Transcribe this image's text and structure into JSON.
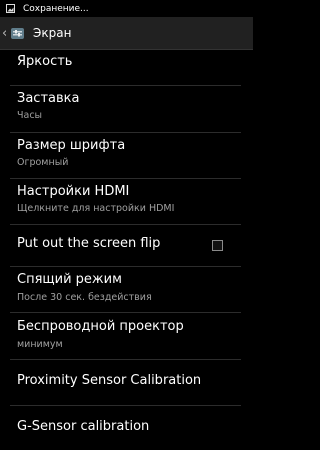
{
  "status_bar": {
    "notification": "Сохранение..."
  },
  "action_bar": {
    "title": "Экран"
  },
  "settings": {
    "brightness": {
      "title": "Яркость"
    },
    "screensaver": {
      "title": "Заставка",
      "summary": "Часы"
    },
    "font_size": {
      "title": "Размер шрифта",
      "summary": "Огромный"
    },
    "hdmi": {
      "title": "Настройки HDMI",
      "summary": "Щелкните для настройки HDMI"
    },
    "screen_flip": {
      "title": "Put out the screen flip",
      "checked": false
    },
    "sleep": {
      "title": "Спящий режим",
      "summary": "После 30 сек. бездействия"
    },
    "wireless_projector": {
      "title": "Беспроводной проектор",
      "summary": "минимум"
    },
    "proximity": {
      "title": "Proximity Sensor Calibration"
    },
    "gsensor": {
      "title": "G-Sensor calibration"
    }
  },
  "colors": {
    "background": "#000000",
    "action_bar": "#212121",
    "summary_text": "#a0a0a0",
    "divider": "#2c2c2c"
  }
}
